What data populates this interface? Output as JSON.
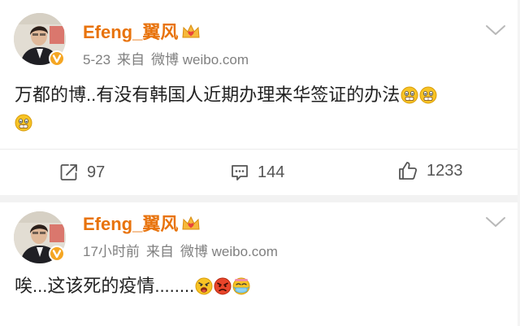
{
  "colors": {
    "username": "#e8730c",
    "meta": "#808080",
    "content": "#222222",
    "verified_badge": "#f5a623",
    "emoji_yellow": "#f7c325"
  },
  "posts": [
    {
      "author": "Efeng_翼风",
      "author_badge_icon": "crown-heart-icon",
      "verified_icon": "verified-v-icon",
      "time": "5-23",
      "source_prefix": "来自",
      "source": "微博 weibo.com",
      "text": "万都的博..有没有韩国人近期办理来华签证的办法",
      "emojis": [
        "grimace-emoji",
        "grimace-emoji",
        "grimace-emoji"
      ],
      "actions": [
        {
          "icon": "share-icon",
          "count": "97"
        },
        {
          "icon": "comment-icon",
          "count": "144"
        },
        {
          "icon": "like-icon",
          "count": "1233"
        }
      ]
    },
    {
      "author": "Efeng_翼风",
      "author_badge_icon": "crown-heart-icon",
      "verified_icon": "verified-v-icon",
      "time": "17小时前",
      "source_prefix": "来自",
      "source": "微博 weibo.com",
      "text": "唉...这该死的疫情........",
      "emojis": [
        "angry-shout-emoji",
        "furious-emoji",
        "sick-emoji"
      ]
    }
  ]
}
